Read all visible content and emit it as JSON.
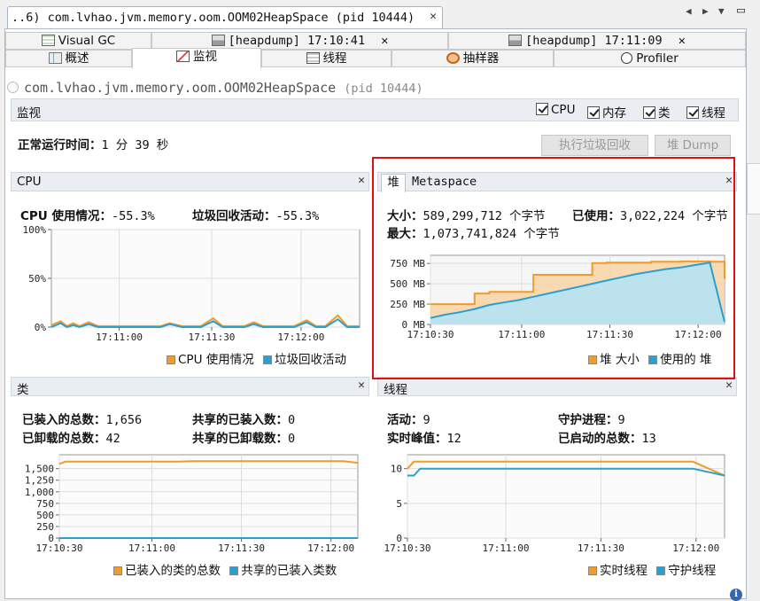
{
  "doc_tab": {
    "title": "..6) com.lvhao.jvm.memory.oom.OOM02HeapSpace (pid 10444)",
    "close": "✕"
  },
  "top_tabs": [
    {
      "label": "Visual GC"
    },
    {
      "label": "[heapdump] 17:10:41",
      "close": "✕"
    },
    {
      "label": "[heapdump] 17:11:09",
      "close": "✕"
    }
  ],
  "sub_tabs": [
    {
      "label": "概述"
    },
    {
      "label": "监视"
    },
    {
      "label": "线程"
    },
    {
      "label": "抽样器"
    },
    {
      "label": "Profiler"
    }
  ],
  "app": {
    "name": "com.lvhao.jvm.memory.oom.OOM02HeapSpace",
    "pid": "(pid 10444)"
  },
  "monitor": {
    "label": "监视",
    "checks": [
      {
        "label": "CPU",
        "checked": true
      },
      {
        "label": "内存",
        "checked": true
      },
      {
        "label": "类",
        "checked": true
      },
      {
        "label": "线程",
        "checked": true
      }
    ],
    "uptime_label": "正常运行时间：",
    "uptime_value": "1 分 39 秒",
    "gc_button": "执行垃圾回收",
    "dump_button": "堆 Dump"
  },
  "cpu": {
    "title": "CPU",
    "usage_label": "CPU 使用情况：",
    "usage_value": "-55.3%",
    "gc_label": "垃圾回收活动：",
    "gc_value": "-55.3%",
    "legend": [
      "CPU 使用情况",
      "垃圾回收活动"
    ]
  },
  "heap": {
    "tab_heap": "堆",
    "tab_meta": "Metaspace",
    "size_label": "大小：",
    "size_value": "589,299,712 个字节",
    "used_label": "已使用：",
    "used_value": "3,022,224 个字节",
    "max_label": "最大：",
    "max_value": "1,073,741,824 个字节",
    "legend": [
      "堆 大小",
      "使用的 堆"
    ]
  },
  "classes": {
    "title": "类",
    "loaded_label": "已装入的总数：",
    "loaded_value": "1,656",
    "unloaded_label": "已卸载的总数：",
    "unloaded_value": "42",
    "shared_loaded_label": "共享的已装入数：",
    "shared_loaded_value": "0",
    "shared_unloaded_label": "共享的已卸载数：",
    "shared_unloaded_value": "0",
    "legend": [
      "已装入的类的总数",
      "共享的已装入类数"
    ]
  },
  "threads": {
    "title": "线程",
    "live_label": "活动：",
    "live_value": "9",
    "peak_label": "实时峰值：",
    "peak_value": "12",
    "daemon_label": "守护进程：",
    "daemon_value": "9",
    "started_label": "已启动的总数：",
    "started_value": "13",
    "legend": [
      "实时线程",
      "守护线程"
    ]
  },
  "colors": {
    "orange": "#f29b2b",
    "blue": "#2a9fd0",
    "heap_fill": "#f7d3a6",
    "used_fill": "#b5e3f3"
  },
  "chart_data": [
    {
      "type": "line",
      "name_ref": "cpu",
      "ytick_labels": [
        "100%",
        "50%",
        "0%"
      ],
      "xtick_labels": [
        "17:11:00",
        "17:11:30",
        "17:12:00"
      ],
      "ylim": [
        0,
        100
      ],
      "x": [
        0,
        3,
        5,
        7,
        9,
        12,
        15,
        18,
        21,
        25,
        28,
        31,
        35,
        38,
        42,
        45,
        48,
        52,
        55,
        58,
        62,
        65,
        68,
        72,
        75,
        78,
        82,
        85,
        88,
        92,
        95,
        99
      ],
      "series": [
        {
          "values": [
            2,
            6,
            1,
            4,
            1,
            5,
            1,
            1,
            1,
            1,
            1,
            1,
            1,
            4,
            1,
            1,
            1,
            9,
            1,
            1,
            1,
            5,
            1,
            1,
            1,
            1,
            7,
            1,
            1,
            12,
            1,
            1
          ]
        },
        {
          "values": [
            0,
            4,
            0,
            2,
            0,
            3,
            0,
            0,
            0,
            0,
            0,
            0,
            0,
            3,
            0,
            0,
            0,
            6,
            0,
            0,
            0,
            3,
            0,
            0,
            0,
            0,
            5,
            0,
            0,
            8,
            0,
            0
          ]
        }
      ]
    },
    {
      "type": "area",
      "name_ref": "heap",
      "ytick_labels": [
        "750 MB",
        "500 MB",
        "250 MB",
        "0 MB"
      ],
      "xtick_labels": [
        "17:10:30",
        "17:11:00",
        "17:11:30",
        "17:12:00"
      ],
      "ylim": [
        0,
        850
      ],
      "x": [
        0,
        5,
        10,
        15,
        20,
        25,
        30,
        35,
        40,
        45,
        50,
        55,
        60,
        65,
        70,
        75,
        80,
        85,
        90,
        95,
        100
      ],
      "series": [
        {
          "values": [
            250,
            250,
            250,
            380,
            400,
            400,
            400,
            610,
            610,
            610,
            610,
            755,
            760,
            760,
            760,
            770,
            770,
            775,
            775,
            770,
            560
          ]
        },
        {
          "values": [
            80,
            120,
            150,
            190,
            240,
            270,
            300,
            340,
            380,
            420,
            460,
            500,
            540,
            580,
            620,
            650,
            680,
            700,
            730,
            760,
            30
          ]
        }
      ]
    },
    {
      "type": "line",
      "name_ref": "classes",
      "ytick_labels": [
        "1,500",
        "1,250",
        "1,000",
        "750",
        "500",
        "250",
        "0"
      ],
      "xtick_labels": [
        "17:10:30",
        "17:11:00",
        "17:11:30",
        "17:12:00"
      ],
      "ylim": [
        0,
        1800
      ],
      "x": [
        0,
        2,
        5,
        20,
        40,
        45,
        60,
        80,
        95,
        100
      ],
      "series": [
        {
          "values": [
            1600,
            1650,
            1650,
            1650,
            1650,
            1660,
            1660,
            1660,
            1660,
            1625
          ]
        },
        {
          "values": [
            0,
            0,
            0,
            0,
            0,
            0,
            0,
            0,
            0,
            0
          ]
        }
      ]
    },
    {
      "type": "line",
      "name_ref": "threads",
      "ytick_labels": [
        "10",
        "5",
        "0"
      ],
      "xtick_labels": [
        "17:10:30",
        "17:11:00",
        "17:11:30",
        "17:12:00"
      ],
      "ylim": [
        0,
        12
      ],
      "x": [
        0,
        2,
        4,
        30,
        60,
        90,
        100
      ],
      "series": [
        {
          "values": [
            10,
            11,
            11,
            11,
            11,
            11,
            9
          ]
        },
        {
          "values": [
            9,
            9,
            10,
            10,
            10,
            10,
            9
          ]
        }
      ]
    }
  ]
}
